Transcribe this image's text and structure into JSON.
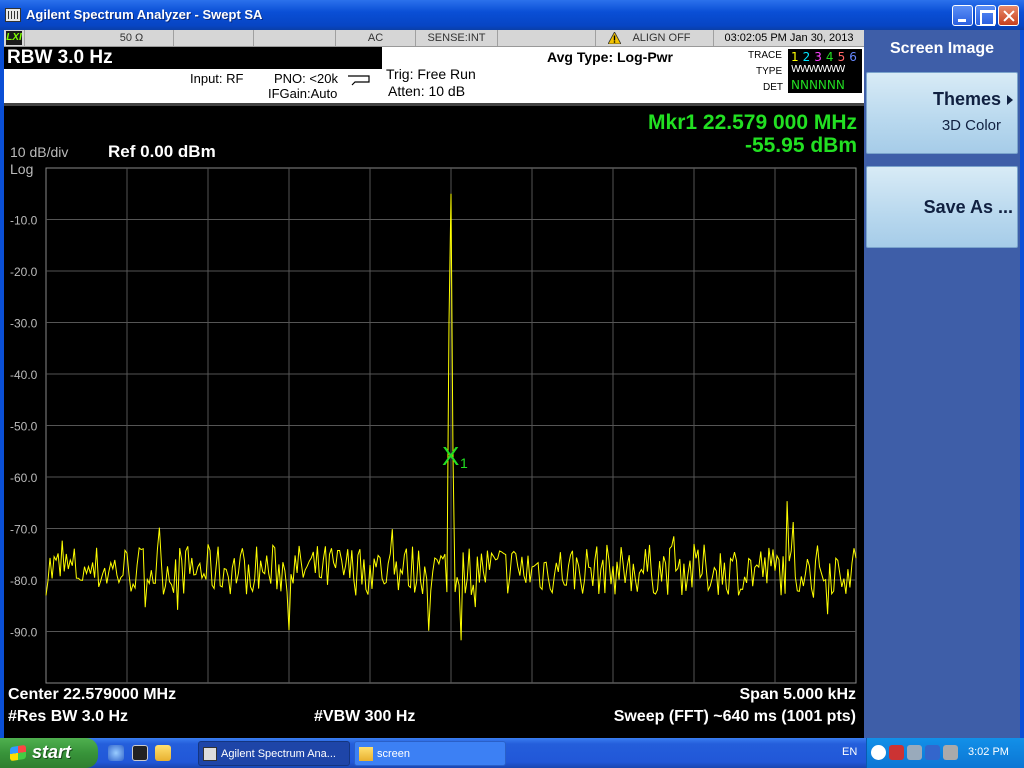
{
  "window": {
    "title": "Agilent Spectrum Analyzer - Swept SA",
    "app_icon": "analyzer-icon"
  },
  "status_bar": {
    "lxi": "LXI",
    "impedance": "50 Ω",
    "coupling": "AC",
    "sense": "SENSE:INT",
    "align": "ALIGN OFF",
    "datetime": "03:02:05 PM Jan 30, 2013"
  },
  "setup": {
    "rbw": "RBW  3.0 Hz",
    "input": "Input: RF",
    "pno": "PNO: <20k",
    "ifgain": "IFGain:Auto",
    "trig": "Trig: Free Run",
    "atten": "Atten: 10 dB",
    "avg_type": "Avg Type: Log-Pwr",
    "trace_label": "TRACE",
    "type_label": "TYPE",
    "det_label": "DET",
    "trace_numbers": [
      "1",
      "2",
      "3",
      "4",
      "5",
      "6"
    ],
    "trace_colors": [
      "#ffff00",
      "#00e5ff",
      "#ff44ff",
      "#22dd22",
      "#ff6666",
      "#6688ff"
    ],
    "type_values": "WWWWWW",
    "det_values": "NNNNNN"
  },
  "display": {
    "scale": "10 dB/div",
    "scale_type": "Log",
    "ref_level": "Ref 0.00 dBm",
    "marker_freq": "Mkr1 22.579 000 MHz",
    "marker_amp": "-55.95 dBm",
    "marker_label": "X",
    "marker_index": "1",
    "center": "Center 22.579000 MHz",
    "span": "Span 5.000 kHz",
    "res_bw": "#Res BW 3.0 Hz",
    "vbw": "#VBW 300 Hz",
    "sweep": "Sweep (FFT)  ~640 ms (1001 pts)"
  },
  "chart_data": {
    "type": "line",
    "ref_level_dbm": 0,
    "scale_db_per_div": 10,
    "ylim": [
      -100,
      0
    ],
    "y_tick_labels": [
      "-10.0",
      "-20.0",
      "-30.0",
      "-40.0",
      "-50.0",
      "-60.0",
      "-70.0",
      "-80.0",
      "-90.0"
    ],
    "y_tick_values": [
      -10,
      -20,
      -30,
      -40,
      -50,
      -60,
      -70,
      -80,
      -90
    ],
    "x_center_mhz": 22.579,
    "x_span_khz": 5.0,
    "points": 1001,
    "noise_floor_dbm": -78,
    "peak_freq_mhz": 22.579,
    "peak_dbm": -5,
    "marker": {
      "freq_mhz": 22.579,
      "amp_dbm": -55.95
    },
    "trace_color": "#ffff00",
    "grid": true
  },
  "softkeys": {
    "header": "Screen Image",
    "themes_label": "Themes",
    "themes_value": "3D Color",
    "save_as": "Save As ..."
  },
  "taskbar": {
    "start": "start",
    "task1": "Agilent Spectrum Ana...",
    "task2": "screen",
    "lang": "EN",
    "clock": "3:02 PM"
  }
}
